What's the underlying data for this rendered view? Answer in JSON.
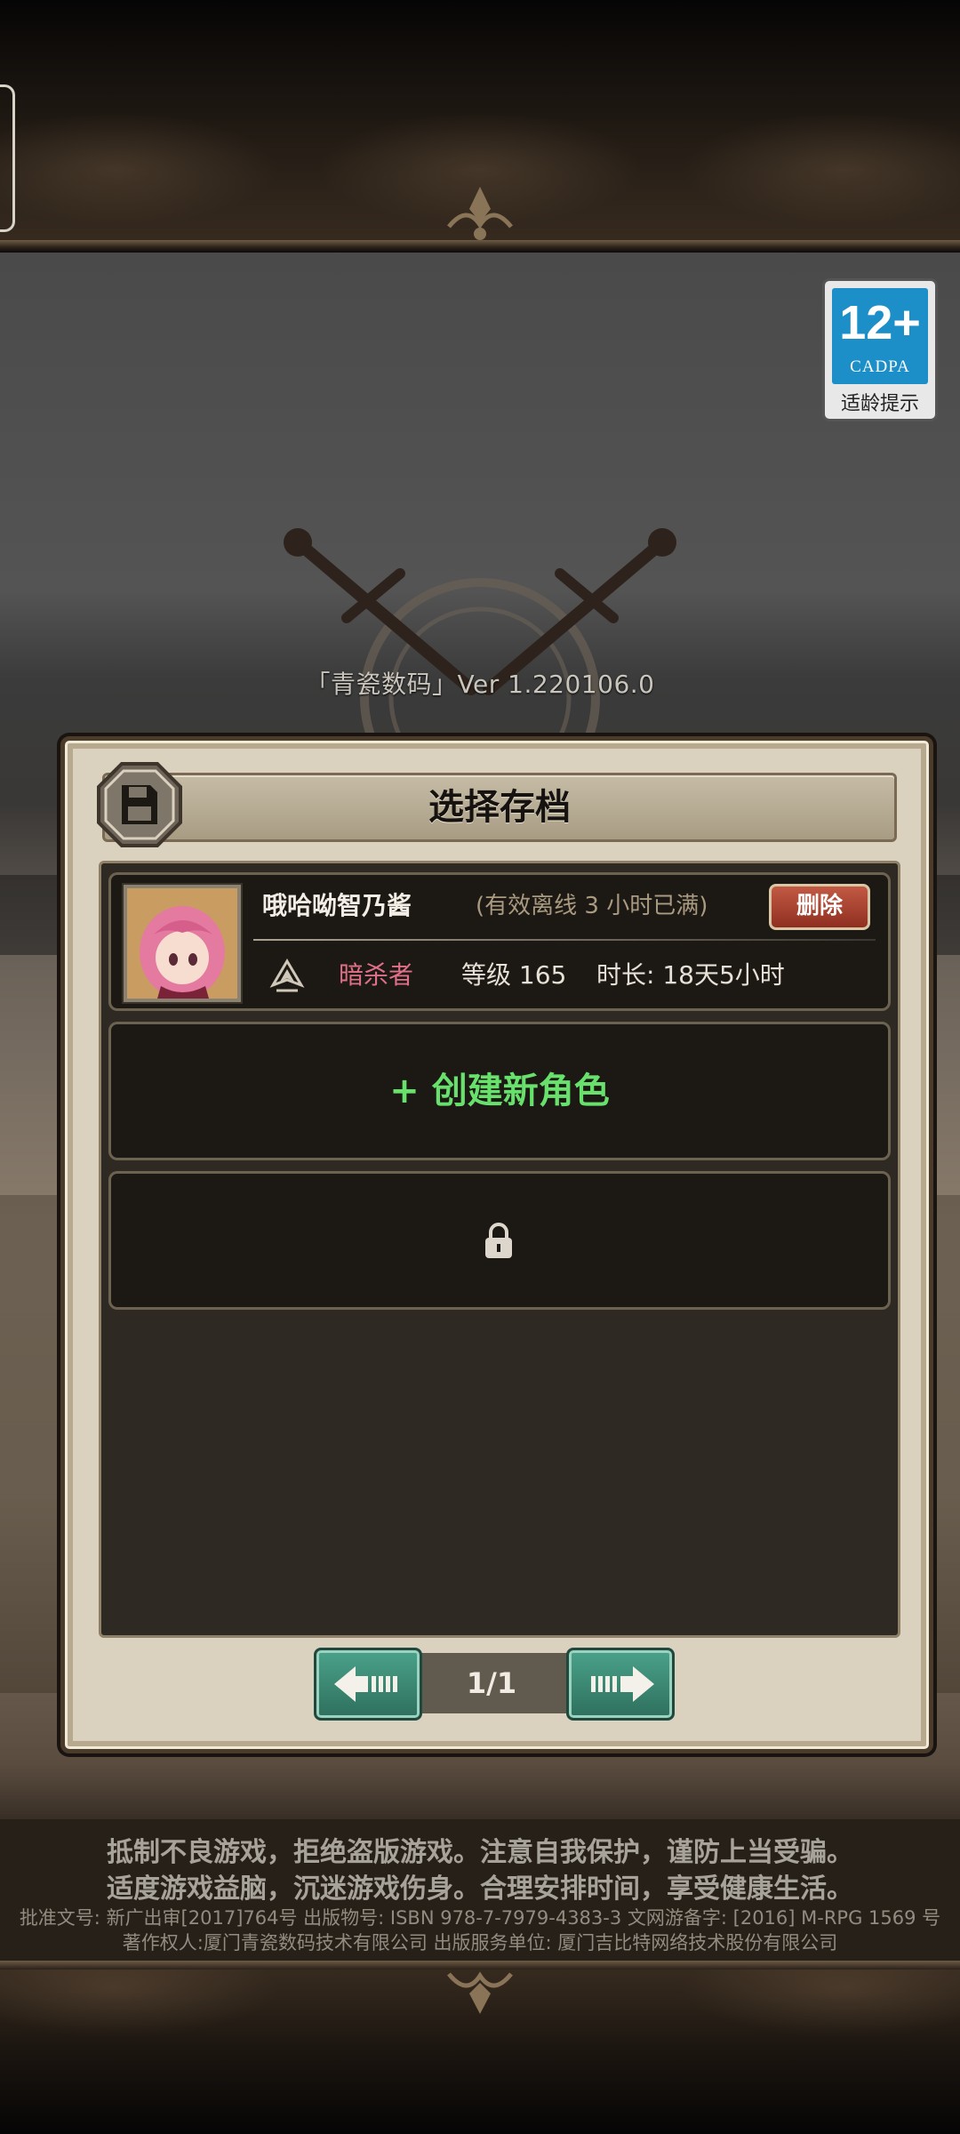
{
  "version_text": "「青瓷数码」Ver 1.220106.0",
  "age_rating": {
    "number": "12+",
    "org": "CADPA",
    "tip": "适龄提示",
    "color": "#1d8fc8"
  },
  "dialog": {
    "title": "选择存档",
    "icon": "floppy-disk-icon",
    "slots": [
      {
        "type": "character",
        "name": "哦哈呦智乃酱",
        "offline_note": "(有效离线 3 小时已满)",
        "delete_label": "删除",
        "class_icon": "class-emblem-icon",
        "class_name": "暗杀者",
        "class_color": "#e07088",
        "level": "等级 165",
        "playtime": "时长: 18天5小时"
      },
      {
        "type": "create",
        "label": "+ 创建新角色",
        "color": "#67e06c"
      },
      {
        "type": "locked",
        "icon": "lock-icon"
      }
    ],
    "pager": {
      "prev_icon": "arrow-left-icon",
      "next_icon": "arrow-right-icon",
      "page_text": "1/1"
    }
  },
  "notices": {
    "line1": "抵制不良游戏，拒绝盗版游戏。注意自我保护，谨防上当受骗。",
    "line2": "适度游戏益脑，沉迷游戏伤身。合理安排时间，享受健康生活。",
    "license1": "批准文号: 新广出审[2017]764号 出版物号: ISBN 978-7-7979-4383-3 文网游备字: [2016] M-RPG 1569 号",
    "license2": "著作权人:厦门青瓷数码技术有限公司 出版服务单位: 厦门吉比特网络技术股份有限公司"
  }
}
